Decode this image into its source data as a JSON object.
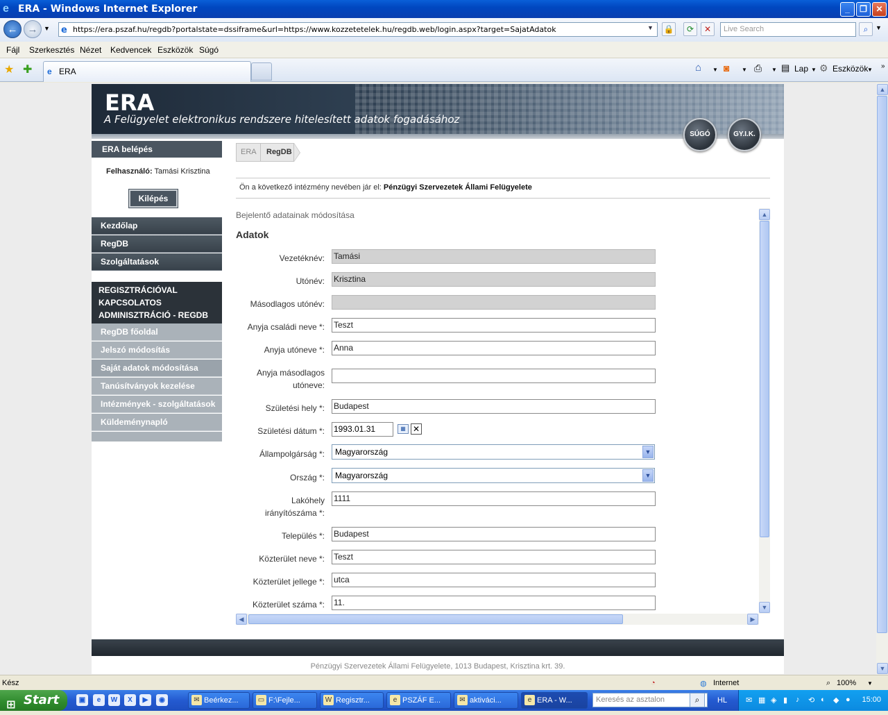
{
  "window": {
    "title": "ERA - Windows Internet Explorer",
    "address": "https://era.pszaf.hu/regdb?portalstate=dssiframe&url=https://www.kozzetetelek.hu/regdb.web/login.aspx?target=SajatAdatok",
    "search_placeholder": "Live Search"
  },
  "menu": [
    "Fájl",
    "Szerkesztés",
    "Nézet",
    "Kedvencek",
    "Eszközök",
    "Súgó"
  ],
  "tab": {
    "label": "ERA"
  },
  "toolbar_right": {
    "page": "Lap",
    "tools": "Eszközök"
  },
  "banner": {
    "title": "ERA",
    "subtitle": "A Felügyelet elektronikus rendszere hitelesített adatok fogadásához",
    "help": "SÚGÓ",
    "faq": "GY.I.K."
  },
  "sidebar": {
    "login_header": "ERA belépés",
    "user_label": "Felhasználó:",
    "user_name": "Tamási Krisztina",
    "logout": "Kilépés",
    "nav": [
      "Kezdőlap",
      "RegDB",
      "Szolgáltatások"
    ],
    "section": "REGISZTRÁCIÓVAL KAPCSOLATOS ADMINISZTRÁCIÓ - REGDB",
    "sub": [
      "RegDB főoldal",
      "Jelszó módosítás",
      "Saját adatok módosítása",
      "Tanúsítványok kezelése",
      "Intézmények - szolgáltatások",
      "Küldeménynapló"
    ]
  },
  "breadcrumb": [
    "ERA",
    "RegDB"
  ],
  "institution": {
    "prefix": "Ön a következő intézmény nevében jár el:",
    "name": "Pénzügyi Szervezetek Állami Felügyelete"
  },
  "form": {
    "title": "Bejelentő adatainak módosítása",
    "section": "Adatok",
    "fields": {
      "last_name": {
        "label": "Vezetéknév:",
        "value": "Tamási"
      },
      "first_name": {
        "label": "Utónév:",
        "value": "Krisztina"
      },
      "second_first_name": {
        "label": "Másodlagos utónév:",
        "value": ""
      },
      "mother_family": {
        "label": "Anyja családi neve *:",
        "value": "Teszt"
      },
      "mother_first": {
        "label": "Anyja utóneve *:",
        "value": "Anna"
      },
      "mother_second_1": {
        "label": "Anyja másodlagos",
        "value": ""
      },
      "mother_second_2": {
        "label": "utóneve:"
      },
      "birth_place": {
        "label": "Születési hely *:",
        "value": "Budapest"
      },
      "birth_date": {
        "label": "Születési dátum *:",
        "value": "1993.01.31"
      },
      "citizenship": {
        "label": "Állampolgárság *:",
        "value": "Magyarország"
      },
      "country": {
        "label": "Ország *:",
        "value": "Magyarország"
      },
      "zip_1": {
        "label": "Lakóhely",
        "value": "1111"
      },
      "zip_2": {
        "label": "irányítószáma *:"
      },
      "city": {
        "label": "Település *:",
        "value": "Budapest"
      },
      "street_name": {
        "label": "Közterület neve *:",
        "value": "Teszt"
      },
      "street_type": {
        "label": "Közterület jellege *:",
        "value": "utca"
      },
      "street_no": {
        "label": "Közterület száma *:",
        "value": "11."
      }
    }
  },
  "footer": "Pénzügyi Szervezetek Állami Felügyelete, 1013 Budapest, Krisztina krt. 39.",
  "status": {
    "left": "Kész",
    "zone": "Internet",
    "zoom": "100%"
  },
  "taskbar": {
    "start": "Start",
    "tasks": [
      "Beérkez...",
      "F:\\Fejle...",
      "Regisztr...",
      "PSZÁF E...",
      "aktiváci...",
      "ERA - W..."
    ],
    "search_placeholder": "Keresés az asztalon",
    "lang": "HL",
    "clock": "15:00"
  }
}
